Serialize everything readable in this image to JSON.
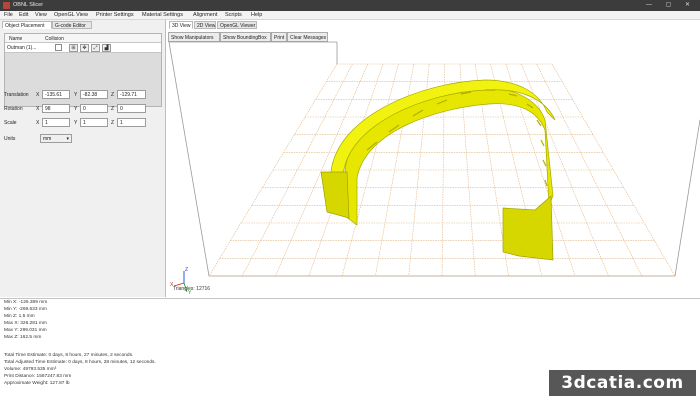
{
  "app": {
    "title": "OBNL Slicer",
    "window_controls": "— ▢ ✕"
  },
  "menu": [
    "File",
    "Edit",
    "View",
    "OpenGL View",
    "Printer Settings",
    "Material Settings",
    "Alignment",
    "Scripts",
    "Help"
  ],
  "left_panel": {
    "tabs": [
      "Object Placement",
      "G-code Editor"
    ],
    "table": {
      "headers": [
        "Name",
        "Collision"
      ],
      "row": {
        "name": "Outman (1)...",
        "collision_checked": false
      },
      "tool_icons": [
        "grid-icon",
        "move-icon",
        "rotate-icon",
        "scale-icon"
      ],
      "tool_glyphs": [
        "⊞",
        "✥",
        "⤢",
        "▟"
      ]
    },
    "translation": {
      "label": "Translation",
      "x": "-135.61",
      "y": "-82.38",
      "z": "-129.71"
    },
    "rotation": {
      "label": "Rotation",
      "x": "98",
      "y": "0",
      "z": "0"
    },
    "scale": {
      "label": "Scale",
      "x": "1",
      "y": "1",
      "z": "1"
    },
    "units": {
      "label": "Units",
      "value": "mm"
    },
    "axis": {
      "x": "X",
      "y": "Y",
      "z": "Z"
    }
  },
  "view": {
    "tabs": [
      "3D View",
      "2D View",
      "OpenGL Viewer"
    ],
    "toolbar": [
      "Show Manipulators",
      "Show BoundingBox",
      "Print",
      "Clear Messages"
    ],
    "triangles": "Triangles: 12716",
    "axis_labels": {
      "x": "X",
      "y": "Y",
      "z": "Z"
    },
    "colors": {
      "model": "#e6e600",
      "grid": "#e0b483",
      "frame": "#9a9a9a",
      "axis_x": "#d02020",
      "axis_y": "#20a020",
      "axis_z": "#2040d0"
    }
  },
  "console": {
    "lines_top": [
      "Min X: -126.389 mm",
      "Min Y: -269.633 mm",
      "Min Z: 1.5 mm",
      "Max X: 326.281 mm",
      "Max Y: 299.031 mm",
      "Max Z: 162.5 mm"
    ],
    "lines_bottom": [
      "Total Time Estimate: 0 days, 8 hours, 27 minutes, 2 seconds.",
      "Total Adjusted Time Estimate: 0 days, 8 hours, 28 minutes, 12 seconds.",
      "Volume: 49793.535 mm³",
      "Print Distance: 1567247.83 mm",
      "Approximate Weight: 127.87 lb"
    ]
  },
  "watermark": "3dcatia.com"
}
